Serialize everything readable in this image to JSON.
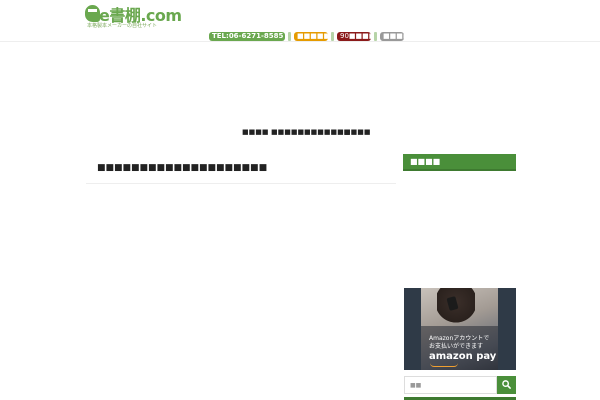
{
  "header": {
    "logo_text": "e書棚.com",
    "logo_sub": "本格製本メーカーの自社サイト",
    "badges": {
      "tel": "TEL:06-6271-8585",
      "orange": "■■■■■■",
      "red": "90■■■■",
      "gray": "■■■■"
    }
  },
  "nav": {
    "items": [
      "■■■■",
      "■■■■■",
      "■■■■■■■",
      "■■■■"
    ]
  },
  "main": {
    "title": "■■■■■■■■■■■■■■■■■■■■"
  },
  "sidebar": {
    "heading": "■■■■",
    "ad": {
      "line1": "Amazonアカウントで",
      "line2": "お支払いができます",
      "brand": "amazon pay"
    },
    "search": {
      "placeholder": "■■"
    }
  },
  "colors": {
    "brand_green": "#6aa84f",
    "sidebar_green": "#4a8f3a",
    "badge_orange": "#e69b00",
    "badge_red": "#8b1a1a",
    "badge_gray": "#999999"
  }
}
